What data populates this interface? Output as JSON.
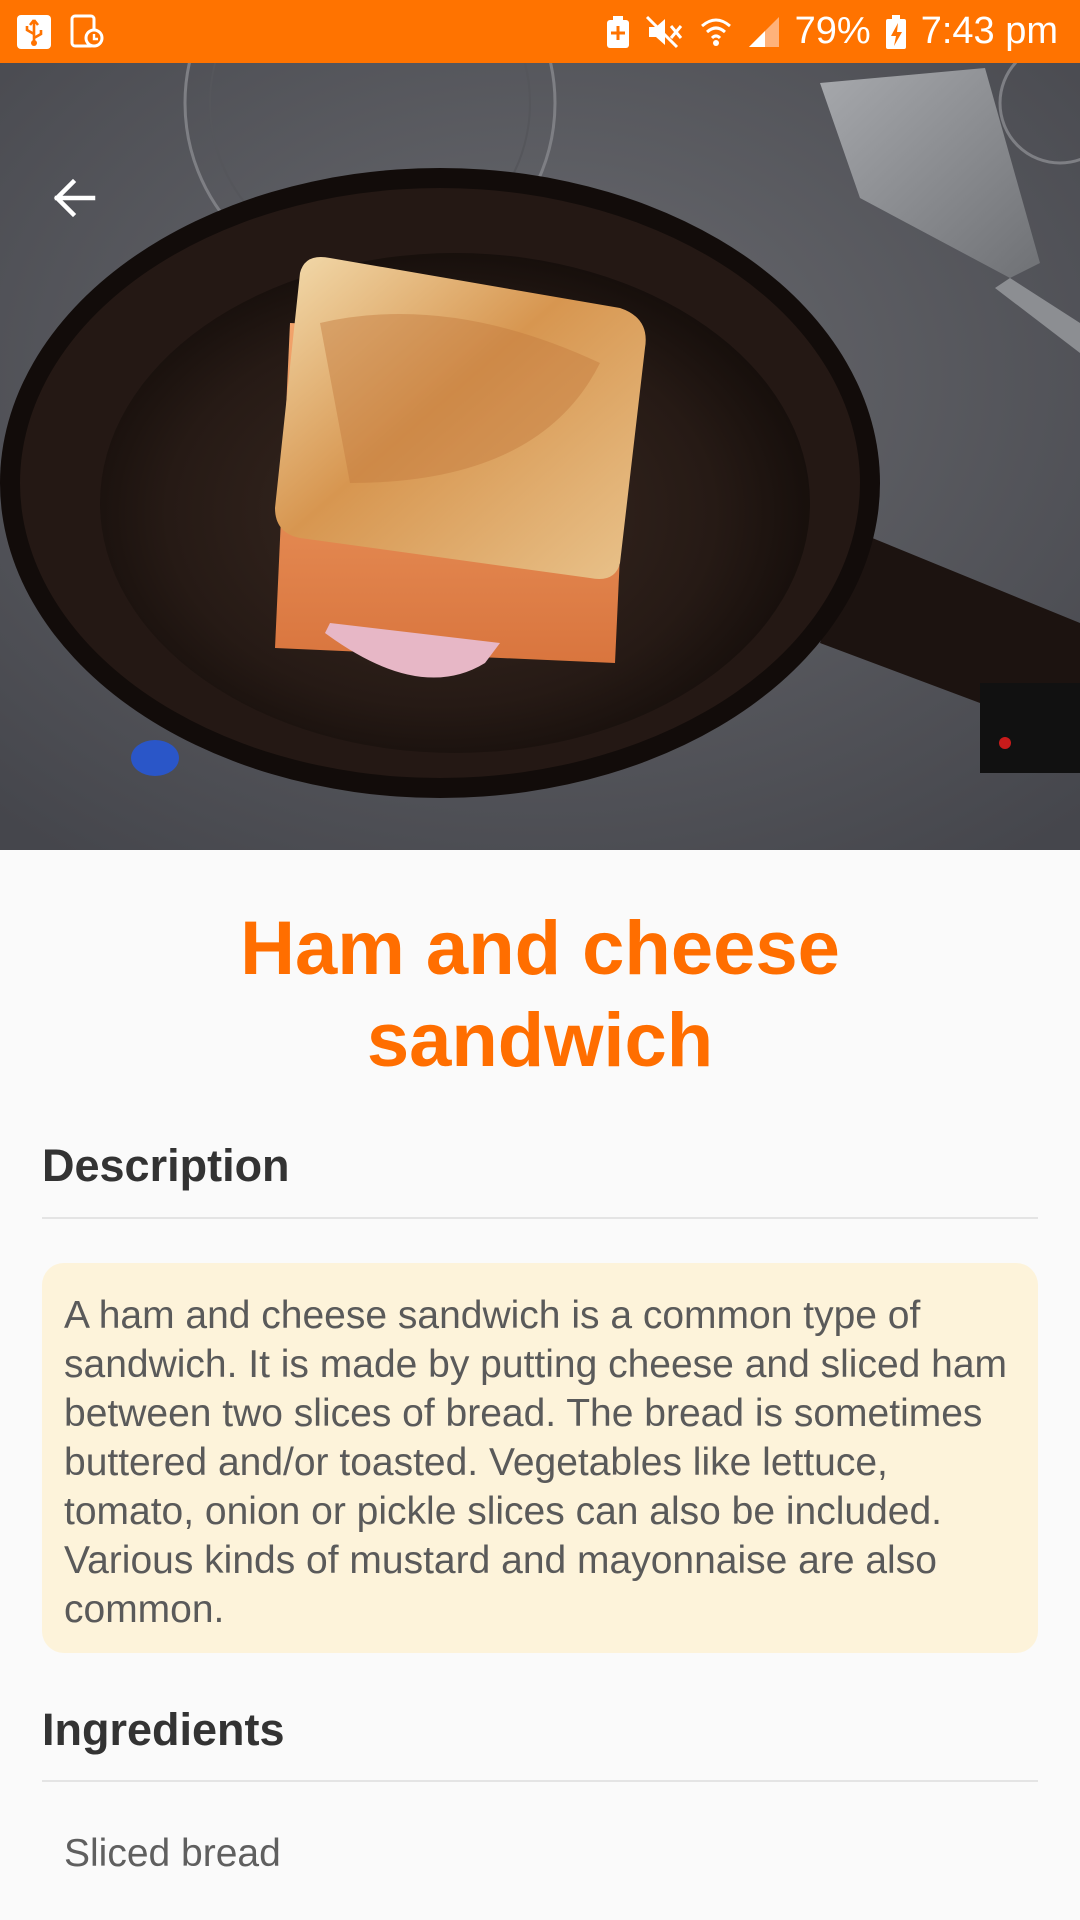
{
  "status_bar": {
    "battery": "79%",
    "time": "7:43 pm",
    "left_icons": [
      "usb-icon",
      "screen-record-icon"
    ],
    "right_icons": [
      "battery-saver-icon",
      "mute-icon",
      "wifi-icon",
      "signal-icon",
      "charging-battery-icon"
    ],
    "background": "#ff7300"
  },
  "hero": {
    "image": "grilled-sandwich-in-skillet-photo",
    "back_icon": "arrow-back-icon"
  },
  "recipe": {
    "title": "Ham and cheese sandwich",
    "description_heading": "Description",
    "description": "A ham and cheese sandwich is a common type of sandwich. It is made by putting cheese and sliced ham between two slices of bread. The bread is sometimes buttered and/or toasted. Vegetables like lettuce, tomato, onion or pickle slices can also be included. Various kinds of mustard and mayonnaise are also common.",
    "ingredients_heading": "Ingredients",
    "ingredients": [
      "Sliced bread"
    ]
  },
  "colors": {
    "accent": "#ff6e00",
    "card_bg": "#fdf3da",
    "page_bg": "#fafafa"
  }
}
